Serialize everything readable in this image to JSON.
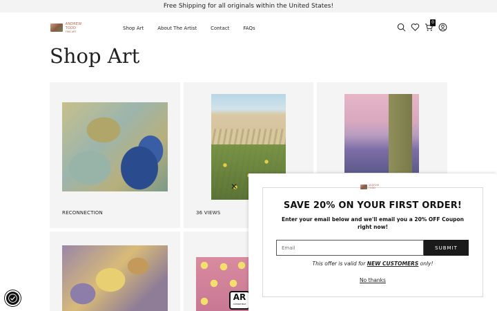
{
  "announcement": "Free Shipping for all originals within the United States!",
  "brand": {
    "name": "ANDREW TODD",
    "sub": "FINE ART"
  },
  "nav": [
    "Shop Art",
    "About The Artist",
    "Contact",
    "FAQs"
  ],
  "header_icons": [
    "search-icon",
    "heart-icon",
    "cart-icon",
    "account-icon"
  ],
  "cart_count": "0",
  "page_title": "Shop Art",
  "products": [
    {
      "label": "RECONNECTION"
    },
    {
      "label": "36 VIEWS"
    },
    {
      "label": ""
    },
    {
      "label": ""
    },
    {
      "label": ""
    }
  ],
  "ar_badge": {
    "text": "AR",
    "sub": "COMPATIBLE"
  },
  "popup": {
    "title": "SAVE 20% ON YOUR FIRST ORDER!",
    "description": "Enter your email below and we'll email you a 20% OFF Coupon right now!",
    "email_placeholder": "Email",
    "submit_label": "SUBMIT",
    "offer_prefix": "This offer is valid for ",
    "offer_highlight": "NEW CUSTOMERS",
    "offer_suffix": " only!",
    "decline_label": "No thanks",
    "close_symbol": "✕"
  },
  "colors": {
    "brand": "#b0634d",
    "button": "#1a1a1a",
    "card_bg": "#f4f4f4"
  }
}
